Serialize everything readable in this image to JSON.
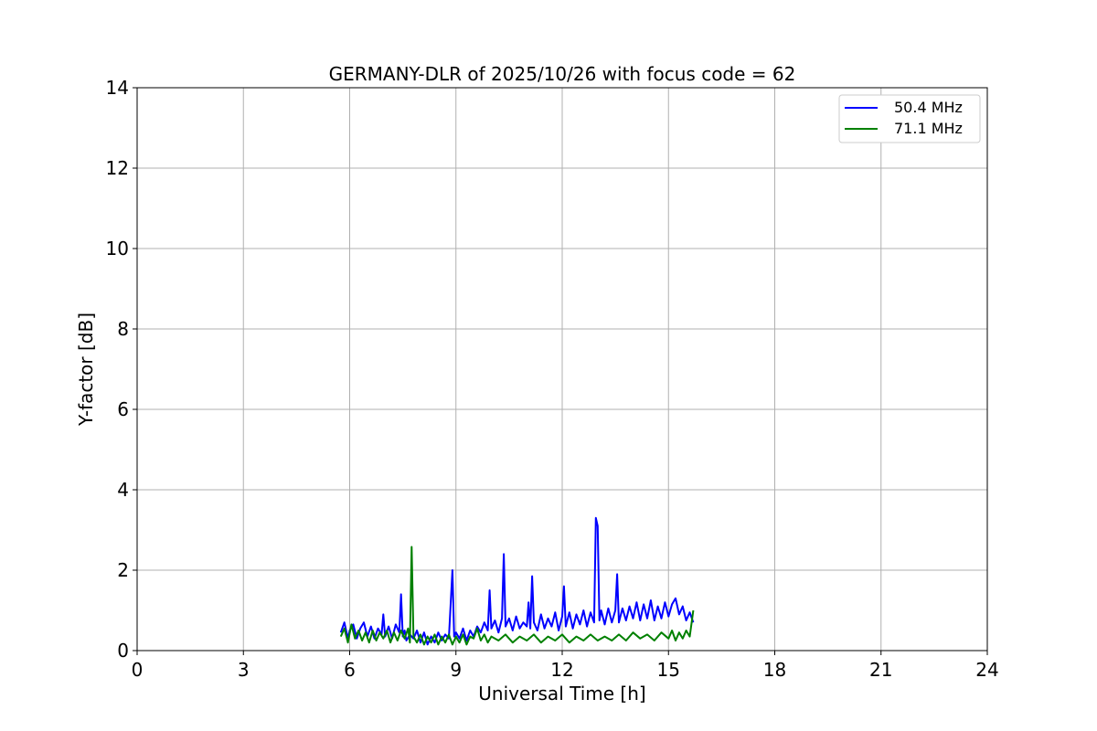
{
  "chart_data": {
    "type": "line",
    "title": "GERMANY-DLR of 2025/10/26 with focus code = 62",
    "xlabel": "Universal Time [h]",
    "ylabel": "Y-factor [dB]",
    "xlim": [
      0,
      24
    ],
    "ylim": [
      0,
      14
    ],
    "xticks": [
      "0",
      "3",
      "6",
      "9",
      "12",
      "15",
      "18",
      "21",
      "24"
    ],
    "yticks": [
      "0",
      "2",
      "4",
      "6",
      "8",
      "10",
      "12",
      "14"
    ],
    "grid": true,
    "legend_position": "top-right",
    "series": [
      {
        "name": "  50.4 MHz",
        "color": "#0000ff",
        "x": [
          5.75,
          5.85,
          5.95,
          6.0,
          6.1,
          6.2,
          6.3,
          6.4,
          6.5,
          6.6,
          6.7,
          6.8,
          6.9,
          6.95,
          7.0,
          7.1,
          7.2,
          7.3,
          7.4,
          7.45,
          7.5,
          7.55,
          7.6,
          7.7,
          7.8,
          7.9,
          8.0,
          8.1,
          8.2,
          8.3,
          8.4,
          8.5,
          8.6,
          8.7,
          8.8,
          8.9,
          8.95,
          9.0,
          9.1,
          9.2,
          9.3,
          9.4,
          9.5,
          9.6,
          9.7,
          9.8,
          9.9,
          9.95,
          10.0,
          10.1,
          10.2,
          10.3,
          10.35,
          10.4,
          10.5,
          10.6,
          10.7,
          10.8,
          10.9,
          11.0,
          11.05,
          11.1,
          11.15,
          11.2,
          11.3,
          11.4,
          11.5,
          11.6,
          11.7,
          11.8,
          11.9,
          12.0,
          12.05,
          12.1,
          12.2,
          12.3,
          12.4,
          12.5,
          12.6,
          12.7,
          12.8,
          12.9,
          12.95,
          13.0,
          13.05,
          13.1,
          13.2,
          13.3,
          13.4,
          13.5,
          13.55,
          13.6,
          13.7,
          13.8,
          13.9,
          14.0,
          14.1,
          14.2,
          14.3,
          14.4,
          14.5,
          14.6,
          14.7,
          14.8,
          14.9,
          15.0,
          15.1,
          15.2,
          15.3,
          15.4,
          15.5,
          15.6,
          15.7
        ],
        "y": [
          0.45,
          0.7,
          0.3,
          0.5,
          0.65,
          0.3,
          0.55,
          0.7,
          0.35,
          0.6,
          0.3,
          0.55,
          0.4,
          0.9,
          0.35,
          0.6,
          0.3,
          0.65,
          0.45,
          1.4,
          0.35,
          0.5,
          0.25,
          0.4,
          0.3,
          0.5,
          0.2,
          0.45,
          0.15,
          0.35,
          0.2,
          0.45,
          0.25,
          0.4,
          0.3,
          2.0,
          0.35,
          0.45,
          0.3,
          0.55,
          0.25,
          0.5,
          0.35,
          0.6,
          0.45,
          0.7,
          0.5,
          1.5,
          0.55,
          0.75,
          0.45,
          0.8,
          2.4,
          0.6,
          0.8,
          0.5,
          0.85,
          0.55,
          0.7,
          0.6,
          1.2,
          0.55,
          1.85,
          0.7,
          0.5,
          0.9,
          0.55,
          0.8,
          0.6,
          0.95,
          0.5,
          0.85,
          1.6,
          0.6,
          0.95,
          0.55,
          0.9,
          0.65,
          1.0,
          0.6,
          0.95,
          0.7,
          3.3,
          3.1,
          0.75,
          1.0,
          0.65,
          1.05,
          0.7,
          1.0,
          1.9,
          0.7,
          1.05,
          0.75,
          1.1,
          0.8,
          1.2,
          0.75,
          1.15,
          0.8,
          1.25,
          0.75,
          1.1,
          0.8,
          1.2,
          0.85,
          1.15,
          1.3,
          0.9,
          1.1,
          0.75,
          0.95,
          0.7
        ]
      },
      {
        "name": "  71.1 MHz",
        "color": "#008000",
        "x": [
          5.75,
          5.85,
          5.95,
          6.05,
          6.15,
          6.25,
          6.35,
          6.45,
          6.55,
          6.65,
          6.75,
          6.85,
          6.95,
          7.05,
          7.15,
          7.25,
          7.35,
          7.45,
          7.55,
          7.65,
          7.7,
          7.75,
          7.8,
          7.9,
          8.0,
          8.1,
          8.2,
          8.3,
          8.4,
          8.5,
          8.6,
          8.7,
          8.8,
          8.9,
          9.0,
          9.1,
          9.2,
          9.3,
          9.4,
          9.5,
          9.6,
          9.7,
          9.8,
          9.9,
          10.0,
          10.2,
          10.4,
          10.6,
          10.8,
          11.0,
          11.2,
          11.4,
          11.6,
          11.8,
          12.0,
          12.2,
          12.4,
          12.6,
          12.8,
          13.0,
          13.2,
          13.4,
          13.6,
          13.8,
          14.0,
          14.2,
          14.4,
          14.6,
          14.8,
          15.0,
          15.1,
          15.2,
          15.3,
          15.4,
          15.5,
          15.6,
          15.7
        ],
        "y": [
          0.35,
          0.55,
          0.2,
          0.65,
          0.3,
          0.5,
          0.25,
          0.45,
          0.2,
          0.5,
          0.25,
          0.45,
          0.3,
          0.5,
          0.2,
          0.45,
          0.25,
          0.5,
          0.3,
          0.55,
          0.2,
          2.58,
          0.35,
          0.2,
          0.4,
          0.15,
          0.35,
          0.2,
          0.4,
          0.15,
          0.35,
          0.2,
          0.4,
          0.15,
          0.35,
          0.2,
          0.4,
          0.15,
          0.35,
          0.3,
          0.55,
          0.25,
          0.4,
          0.2,
          0.35,
          0.25,
          0.4,
          0.2,
          0.35,
          0.25,
          0.4,
          0.2,
          0.35,
          0.25,
          0.4,
          0.2,
          0.35,
          0.25,
          0.4,
          0.25,
          0.35,
          0.25,
          0.4,
          0.25,
          0.45,
          0.3,
          0.4,
          0.25,
          0.45,
          0.3,
          0.5,
          0.25,
          0.45,
          0.3,
          0.5,
          0.35,
          1.0
        ]
      }
    ]
  }
}
